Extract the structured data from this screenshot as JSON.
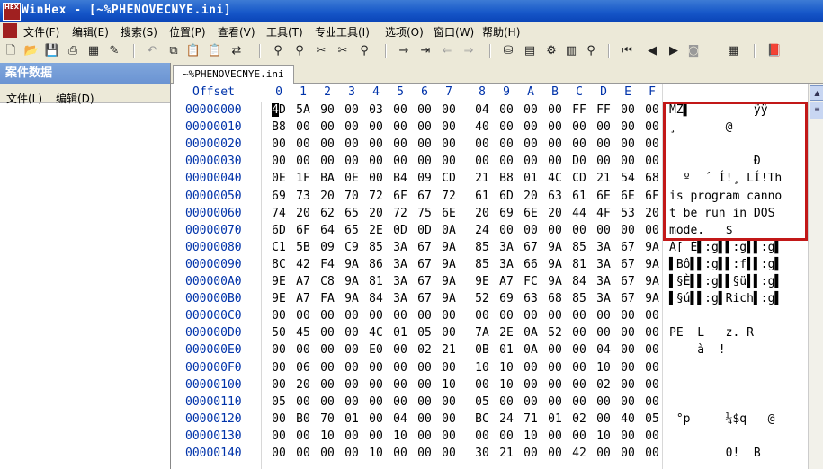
{
  "window": {
    "title": "WinHex - [~%PHENOVECNYE.ini]",
    "app_icon_text": "HEX"
  },
  "menubar": [
    "文件(F)",
    "编辑(E)",
    "搜索(S)",
    "位置(P)",
    "查看(V)",
    "工具(T)",
    "专业工具(I)",
    "选项(O)",
    "窗口(W)",
    "帮助(H)"
  ],
  "left_panel": {
    "header": "案件数据",
    "menu": [
      "文件(L)",
      "编辑(D)"
    ]
  },
  "tab": {
    "label": "~%PHENOVECNYE.ini"
  },
  "hex": {
    "offset_header": "Offset",
    "columns": [
      "0",
      "1",
      "2",
      "3",
      "4",
      "5",
      "6",
      "7",
      "8",
      "9",
      "A",
      "B",
      "C",
      "D",
      "E",
      "F"
    ],
    "rows": [
      {
        "offset": "00000000",
        "bytes": [
          "4D",
          "5A",
          "90",
          "00",
          "03",
          "00",
          "00",
          "00",
          "04",
          "00",
          "00",
          "00",
          "FF",
          "FF",
          "00",
          "00"
        ],
        "ascii": "MZ▌         ÿÿ"
      },
      {
        "offset": "00000010",
        "bytes": [
          "B8",
          "00",
          "00",
          "00",
          "00",
          "00",
          "00",
          "00",
          "40",
          "00",
          "00",
          "00",
          "00",
          "00",
          "00",
          "00"
        ],
        "ascii": "¸       @"
      },
      {
        "offset": "00000020",
        "bytes": [
          "00",
          "00",
          "00",
          "00",
          "00",
          "00",
          "00",
          "00",
          "00",
          "00",
          "00",
          "00",
          "00",
          "00",
          "00",
          "00"
        ],
        "ascii": ""
      },
      {
        "offset": "00000030",
        "bytes": [
          "00",
          "00",
          "00",
          "00",
          "00",
          "00",
          "00",
          "00",
          "00",
          "00",
          "00",
          "00",
          "D0",
          "00",
          "00",
          "00"
        ],
        "ascii": "            Ð"
      },
      {
        "offset": "00000040",
        "bytes": [
          "0E",
          "1F",
          "BA",
          "0E",
          "00",
          "B4",
          "09",
          "CD",
          "21",
          "B8",
          "01",
          "4C",
          "CD",
          "21",
          "54",
          "68"
        ],
        "ascii": "  º  ´ Í!¸ LÍ!Th"
      },
      {
        "offset": "00000050",
        "bytes": [
          "69",
          "73",
          "20",
          "70",
          "72",
          "6F",
          "67",
          "72",
          "61",
          "6D",
          "20",
          "63",
          "61",
          "6E",
          "6E",
          "6F"
        ],
        "ascii": "is program canno"
      },
      {
        "offset": "00000060",
        "bytes": [
          "74",
          "20",
          "62",
          "65",
          "20",
          "72",
          "75",
          "6E",
          "20",
          "69",
          "6E",
          "20",
          "44",
          "4F",
          "53",
          "20"
        ],
        "ascii": "t be run in DOS "
      },
      {
        "offset": "00000070",
        "bytes": [
          "6D",
          "6F",
          "64",
          "65",
          "2E",
          "0D",
          "0D",
          "0A",
          "24",
          "00",
          "00",
          "00",
          "00",
          "00",
          "00",
          "00"
        ],
        "ascii": "mode.   $"
      },
      {
        "offset": "00000080",
        "bytes": [
          "C1",
          "5B",
          "09",
          "C9",
          "85",
          "3A",
          "67",
          "9A",
          "85",
          "3A",
          "67",
          "9A",
          "85",
          "3A",
          "67",
          "9A"
        ],
        "ascii": "Á[ É▌:g▌▌:g▌▌:g▌"
      },
      {
        "offset": "00000090",
        "bytes": [
          "8C",
          "42",
          "F4",
          "9A",
          "86",
          "3A",
          "67",
          "9A",
          "85",
          "3A",
          "66",
          "9A",
          "81",
          "3A",
          "67",
          "9A"
        ],
        "ascii": "▌Bô▌▌:g▌▌:f▌▌:g▌"
      },
      {
        "offset": "000000A0",
        "bytes": [
          "9E",
          "A7",
          "C8",
          "9A",
          "81",
          "3A",
          "67",
          "9A",
          "9E",
          "A7",
          "FC",
          "9A",
          "84",
          "3A",
          "67",
          "9A"
        ],
        "ascii": "▌§È▌▌:g▌▌§ü▌▌:g▌"
      },
      {
        "offset": "000000B0",
        "bytes": [
          "9E",
          "A7",
          "FA",
          "9A",
          "84",
          "3A",
          "67",
          "9A",
          "52",
          "69",
          "63",
          "68",
          "85",
          "3A",
          "67",
          "9A"
        ],
        "ascii": "▌§ú▌▌:g▌Rich▌:g▌"
      },
      {
        "offset": "000000C0",
        "bytes": [
          "00",
          "00",
          "00",
          "00",
          "00",
          "00",
          "00",
          "00",
          "00",
          "00",
          "00",
          "00",
          "00",
          "00",
          "00",
          "00"
        ],
        "ascii": ""
      },
      {
        "offset": "000000D0",
        "bytes": [
          "50",
          "45",
          "00",
          "00",
          "4C",
          "01",
          "05",
          "00",
          "7A",
          "2E",
          "0A",
          "52",
          "00",
          "00",
          "00",
          "00"
        ],
        "ascii": "PE  L   z. R"
      },
      {
        "offset": "000000E0",
        "bytes": [
          "00",
          "00",
          "00",
          "00",
          "E0",
          "00",
          "02",
          "21",
          "0B",
          "01",
          "0A",
          "00",
          "00",
          "04",
          "00",
          "00"
        ],
        "ascii": "    à  !"
      },
      {
        "offset": "000000F0",
        "bytes": [
          "00",
          "06",
          "00",
          "00",
          "00",
          "00",
          "00",
          "00",
          "10",
          "10",
          "00",
          "00",
          "00",
          "10",
          "00",
          "00"
        ],
        "ascii": ""
      },
      {
        "offset": "00000100",
        "bytes": [
          "00",
          "20",
          "00",
          "00",
          "00",
          "00",
          "00",
          "10",
          "00",
          "10",
          "00",
          "00",
          "00",
          "02",
          "00",
          "00"
        ],
        "ascii": ""
      },
      {
        "offset": "00000110",
        "bytes": [
          "05",
          "00",
          "00",
          "00",
          "00",
          "00",
          "00",
          "00",
          "05",
          "00",
          "00",
          "00",
          "00",
          "00",
          "00",
          "00"
        ],
        "ascii": ""
      },
      {
        "offset": "00000120",
        "bytes": [
          "00",
          "B0",
          "70",
          "01",
          "00",
          "04",
          "00",
          "00",
          "BC",
          "24",
          "71",
          "01",
          "02",
          "00",
          "40",
          "05"
        ],
        "ascii": " °p     ¼$q   @"
      },
      {
        "offset": "00000130",
        "bytes": [
          "00",
          "00",
          "10",
          "00",
          "00",
          "10",
          "00",
          "00",
          "00",
          "00",
          "10",
          "00",
          "00",
          "10",
          "00",
          "00"
        ],
        "ascii": ""
      },
      {
        "offset": "00000140",
        "bytes": [
          "00",
          "00",
          "00",
          "00",
          "10",
          "00",
          "00",
          "00",
          "30",
          "21",
          "00",
          "00",
          "42",
          "00",
          "00",
          "00"
        ],
        "ascii": "        0!  B"
      }
    ]
  },
  "colors": {
    "highlight_border": "#c21818",
    "offset_blue": "#0033aa",
    "title_blue": "#1556c8"
  },
  "icons": [
    "new-file-icon",
    "open-folder-icon",
    "save-icon",
    "print-icon",
    "properties-icon",
    "undo-icon",
    "copy-icon",
    "paste-icon",
    "paste-special-icon",
    "convert-icon",
    "find-icon",
    "find-hex-icon",
    "replace-icon",
    "replace-hex-icon",
    "find-next-icon",
    "goto-offset-icon",
    "goto-page-icon",
    "back-icon",
    "forward-icon",
    "disk-icon",
    "ram-icon",
    "tools-icon",
    "calc-icon",
    "search-icon",
    "prev-icon",
    "play-left-icon",
    "play-right-icon",
    "camera-icon",
    "table-icon",
    "help-book-icon"
  ]
}
